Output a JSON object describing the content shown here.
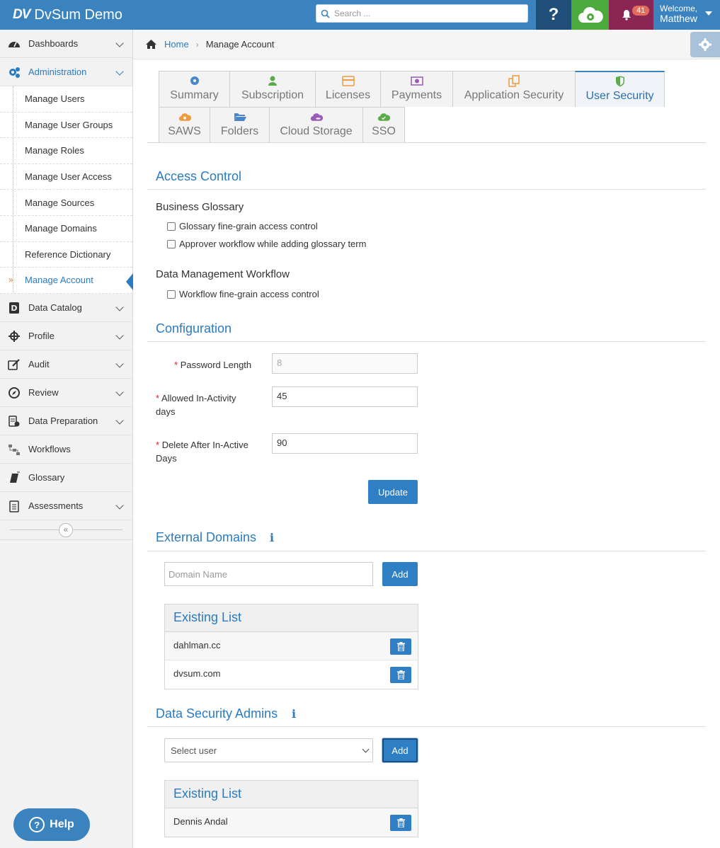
{
  "header": {
    "app_title": "DvSum Demo",
    "search_placeholder": "Search ...",
    "help_label": "?",
    "notification_count": "41",
    "welcome_label": "Welcome,",
    "user_name": "Matthew"
  },
  "sidebar": {
    "items": [
      {
        "label": "Dashboards",
        "icon": "dashboard-icon"
      },
      {
        "label": "Administration",
        "icon": "cogs-icon"
      },
      {
        "label": "Data Catalog",
        "icon": "catalog-icon"
      },
      {
        "label": "Profile",
        "icon": "crosshair-icon"
      },
      {
        "label": "Audit",
        "icon": "edit-icon"
      },
      {
        "label": "Review",
        "icon": "compass-icon"
      },
      {
        "label": "Data Preparation",
        "icon": "data-prep-icon"
      },
      {
        "label": "Workflows",
        "icon": "workflow-icon"
      },
      {
        "label": "Glossary",
        "icon": "book-icon"
      },
      {
        "label": "Assessments",
        "icon": "clipboard-icon"
      }
    ],
    "admin_subitems": [
      "Manage Users",
      "Manage User Groups",
      "Manage Roles",
      "Manage User Access",
      "Manage Sources",
      "Manage Domains",
      "Reference Dictionary",
      "Manage Account"
    ],
    "help_button": "Help"
  },
  "breadcrumb": {
    "home": "Home",
    "current": "Manage Account"
  },
  "tabs": {
    "row1": [
      "Summary",
      "Subscription",
      "Licenses",
      "Payments",
      "Application Security",
      "User Security"
    ],
    "row2": [
      "SAWS",
      "Folders",
      "Cloud Storage",
      "SSO"
    ],
    "active": "User Security"
  },
  "access_control": {
    "title": "Access Control",
    "business_glossary": {
      "title": "Business Glossary",
      "options": [
        "Glossary fine-grain access control",
        "Approver workflow while adding glossary term"
      ]
    },
    "data_management": {
      "title": "Data Management Workflow",
      "options": [
        "Workflow fine-grain access control"
      ]
    }
  },
  "configuration": {
    "title": "Configuration",
    "password_length_label": "Password Length",
    "password_length_value": "8",
    "inactivity_label_1": "Allowed In-Activity",
    "inactivity_label_2": "days",
    "inactivity_value": "45",
    "delete_label_1": "Delete After In-Active",
    "delete_label_2": "Days",
    "delete_value": "90",
    "required_mark": "*",
    "update_button": "Update"
  },
  "external_domains": {
    "title": "External Domains",
    "info": "i",
    "input_placeholder": "Domain Name",
    "add_button": "Add",
    "list_title": "Existing List",
    "items": [
      "dahlman.cc",
      "dvsum.com"
    ]
  },
  "data_security_admins": {
    "title": "Data Security Admins",
    "info": "i",
    "select_value": "Select user",
    "add_button": "Add",
    "list_title": "Existing List",
    "items": [
      "Dennis Andal"
    ]
  },
  "colors": {
    "brand_blue": "#3b83be",
    "link_blue": "#2a7bc0",
    "help_dark": "#1f4e79",
    "cloud_green": "#4caa3c",
    "bell_maroon": "#8b2553",
    "required_red": "#d9232d"
  }
}
